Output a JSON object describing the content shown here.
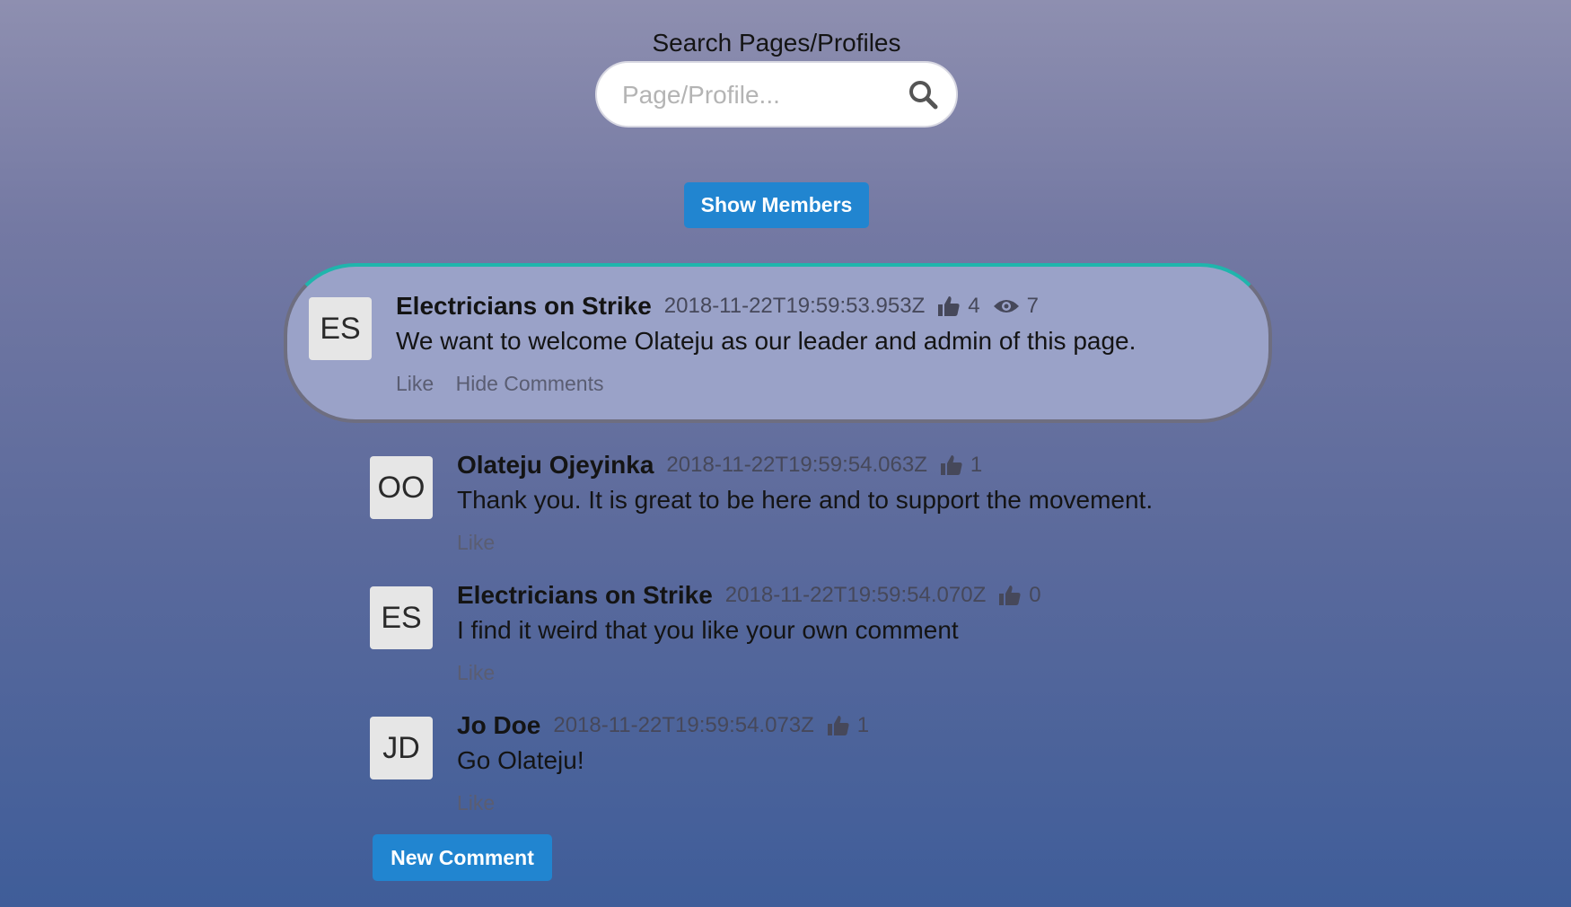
{
  "search": {
    "title": "Search Pages/Profiles",
    "placeholder": "Page/Profile..."
  },
  "buttons": {
    "show_members": "Show Members",
    "new_comment": "New Comment"
  },
  "post": {
    "avatar": "ES",
    "author": "Electricians on Strike",
    "date": "2018-11-22T19:59:53.953Z",
    "likes": "4",
    "views": "7",
    "text": "We want to welcome Olateju as our leader and admin of this page.",
    "actions": [
      "Like",
      "Hide Comments"
    ]
  },
  "comments": [
    {
      "avatar": "OO",
      "author": "Olateju Ojeyinka",
      "date": "2018-11-22T19:59:54.063Z",
      "likes": "1",
      "text": "Thank you. It is great to be here and to support the movement.",
      "action": "Like"
    },
    {
      "avatar": "ES",
      "author": "Electricians on Strike",
      "date": "2018-11-22T19:59:54.070Z",
      "likes": "0",
      "text": "I find it weird that you like your own comment",
      "action": "Like"
    },
    {
      "avatar": "JD",
      "author": "Jo Doe",
      "date": "2018-11-22T19:59:54.073Z",
      "likes": "1",
      "text": "Go Olateju!",
      "action": "Like"
    }
  ],
  "icons": {
    "search": "search-icon",
    "like": "thumbs-up-icon",
    "views": "eye-icon"
  },
  "colors": {
    "button": "#2185d0",
    "post_accent": "#1fb5ac",
    "card_bg": "#9aa2c8"
  }
}
